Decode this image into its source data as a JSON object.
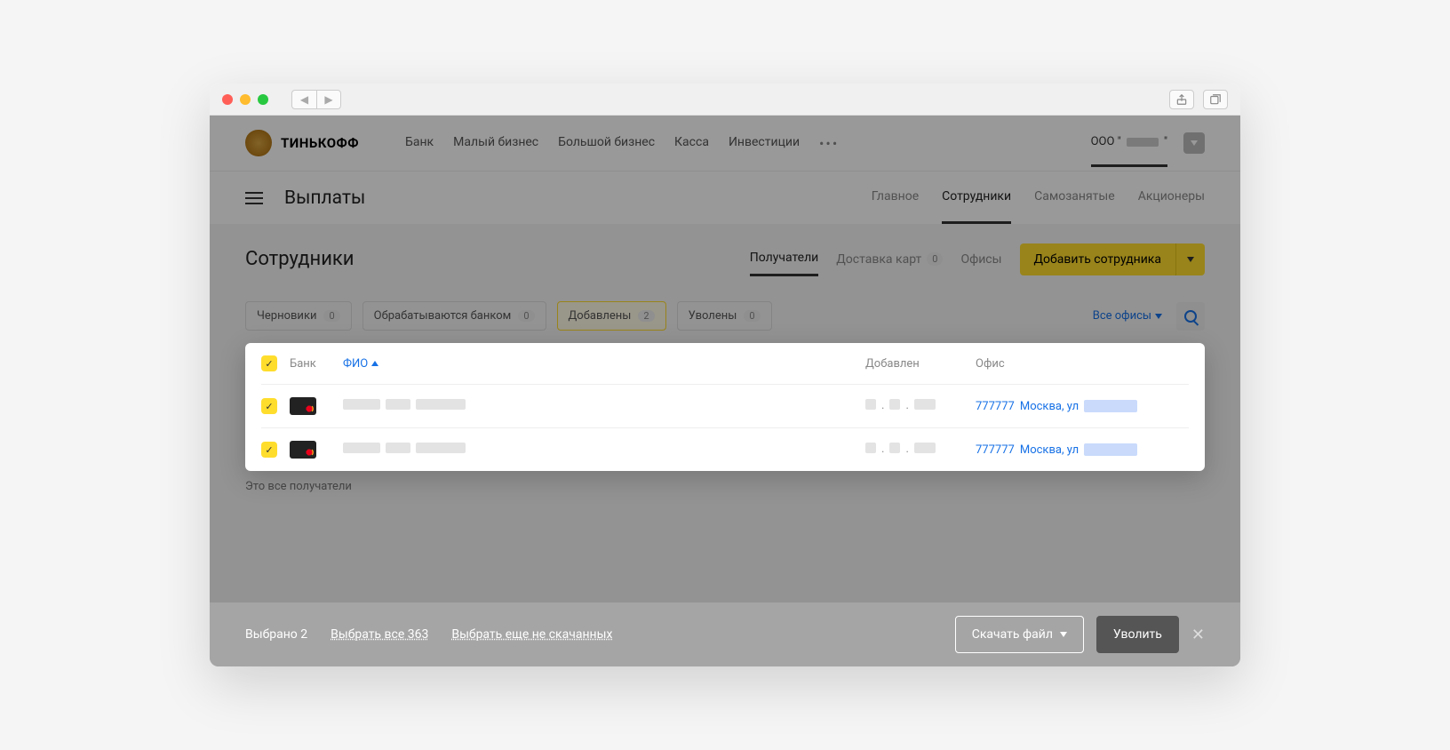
{
  "browser": {
    "share_icon": "share",
    "tabs_icon": "tabs"
  },
  "brand": "ТИНЬКОФФ",
  "topnav": {
    "items": [
      "Банк",
      "Малый бизнес",
      "Большой бизнес",
      "Касса",
      "Инвестиции"
    ],
    "company_prefix": "ООО \""
  },
  "subbar": {
    "title": "Выплаты",
    "tabs": [
      "Главное",
      "Сотрудники",
      "Самозанятые",
      "Акционеры"
    ],
    "active_index": 1
  },
  "page": {
    "title": "Сотрудники",
    "tabs": [
      {
        "label": "Получатели",
        "active": true
      },
      {
        "label": "Доставка карт",
        "count": 0
      },
      {
        "label": "Офисы"
      }
    ],
    "add_button": "Добавить сотрудника"
  },
  "filters": {
    "chips": [
      {
        "label": "Черновики",
        "count": 0
      },
      {
        "label": "Обрабатываются банком",
        "count": 0
      },
      {
        "label": "Добавлены",
        "count": 2,
        "active": true
      },
      {
        "label": "Уволены",
        "count": 0
      }
    ],
    "office_selector": "Все офисы"
  },
  "table": {
    "headers": {
      "bank": "Банк",
      "fio": "ФИО",
      "added": "Добавлен",
      "office": "Офис"
    },
    "rows": [
      {
        "date_mask": " .  . ",
        "office_code": "777777",
        "office_city": "Москва, ул"
      },
      {
        "date_mask": " .  . ",
        "office_code": "777777",
        "office_city": "Москва, ул"
      }
    ]
  },
  "hint": "Это все получатели",
  "bottom": {
    "selected_label": "Выбрано 2",
    "select_all": "Выбрать все 363",
    "select_remaining": "Выбрать еще не скачанных",
    "download": "Скачать файл",
    "fire": "Уволить"
  }
}
